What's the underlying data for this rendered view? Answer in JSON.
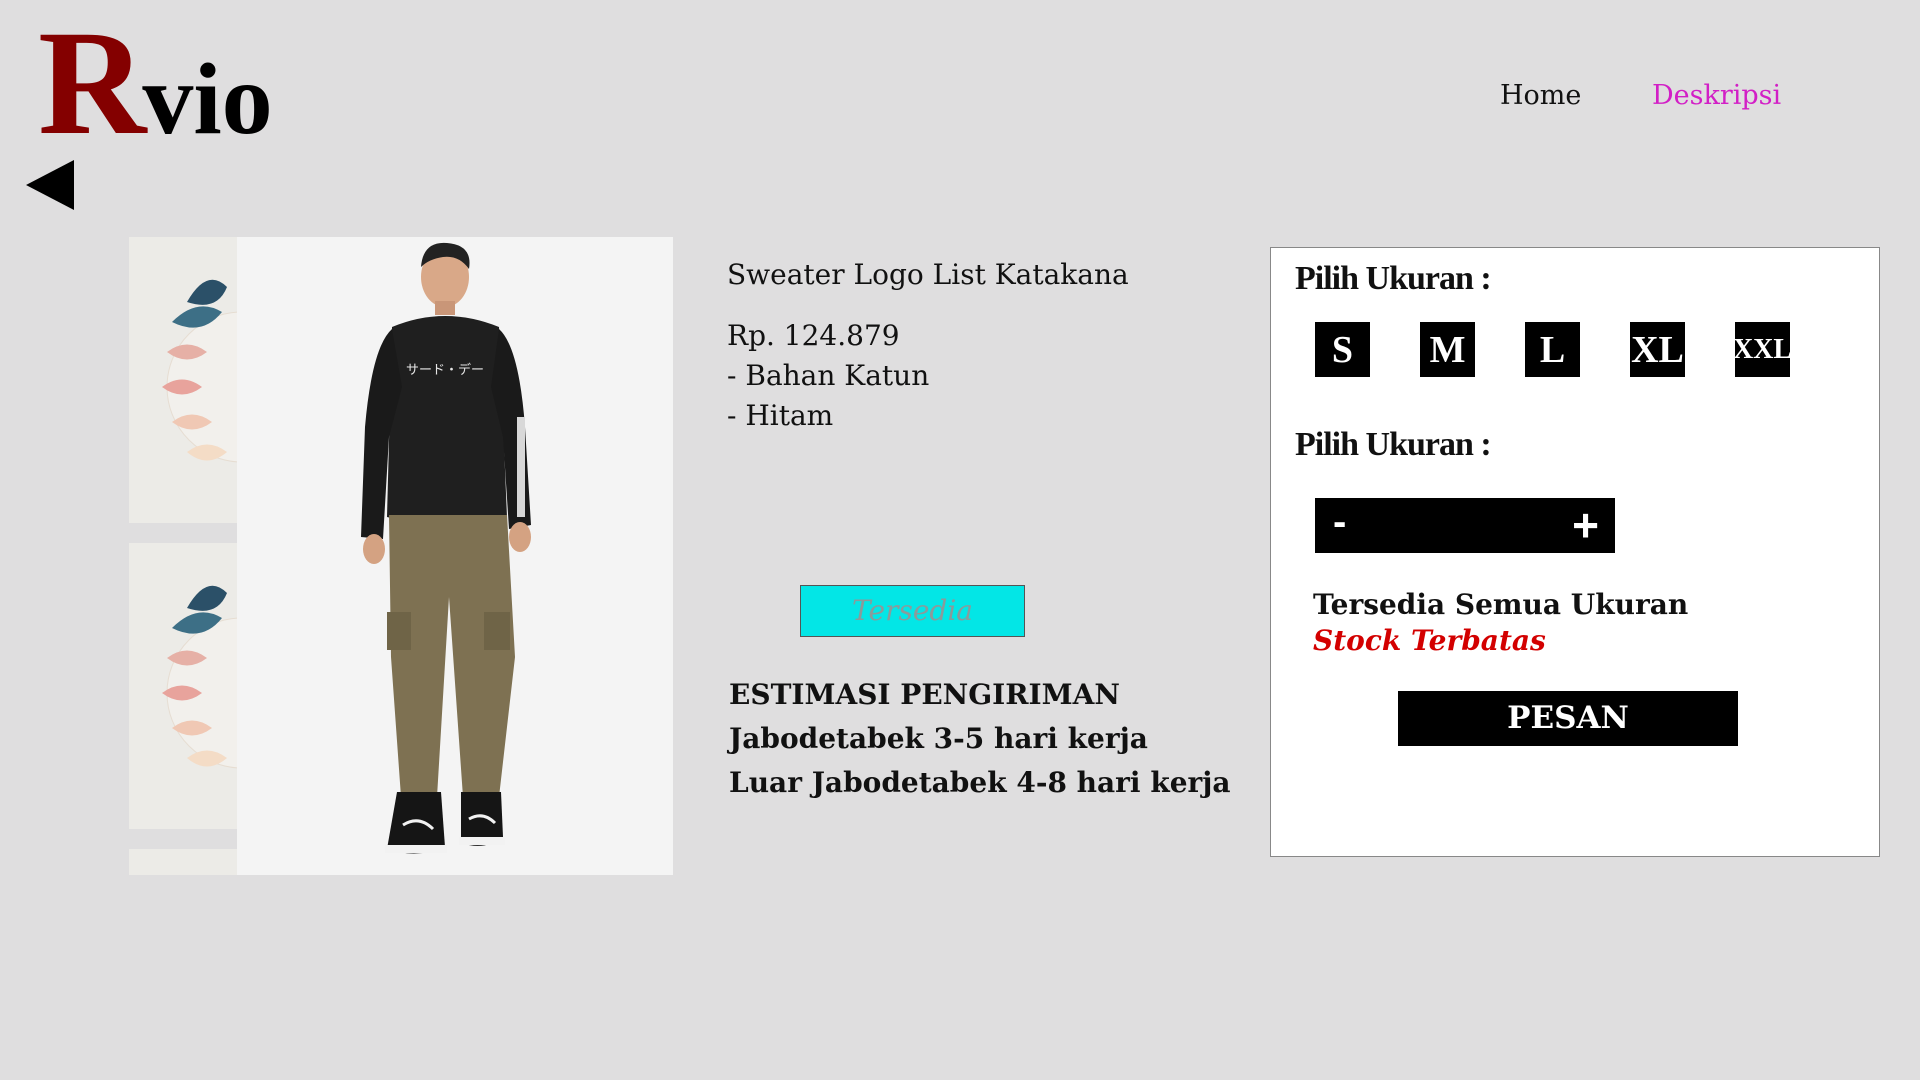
{
  "brand": {
    "logo_initial": "R",
    "logo_rest": "vio",
    "initial_color": "#840000"
  },
  "nav": {
    "home": "Home",
    "description": "Deskripsi",
    "active_color": "#d21fc6"
  },
  "product": {
    "name": "Sweater Logo List Katakana",
    "price": "Rp. 124.879",
    "material": "- Bahan Katun",
    "color": "- Hitam",
    "shirt_print": "サード・デー",
    "stock_badge": "Tersedia"
  },
  "shipping": {
    "heading": "ESTIMASI PENGIRIMAN",
    "line1": "Jabodetabek 3-5 hari kerja",
    "line2": "Luar Jabodetabek 4-8 hari kerja"
  },
  "order_panel": {
    "size_heading": "Pilih Ukuran :",
    "sizes": [
      "S",
      "M",
      "L",
      "XL",
      "XXL"
    ],
    "qty_heading": "Pilih Ukuran :",
    "minus": "-",
    "plus": "+",
    "availability": "Tersedia Semua Ukuran",
    "stock_note": "Stock Terbatas",
    "order_button": "PESAN"
  },
  "icons": {
    "back": "back-arrow-icon"
  }
}
